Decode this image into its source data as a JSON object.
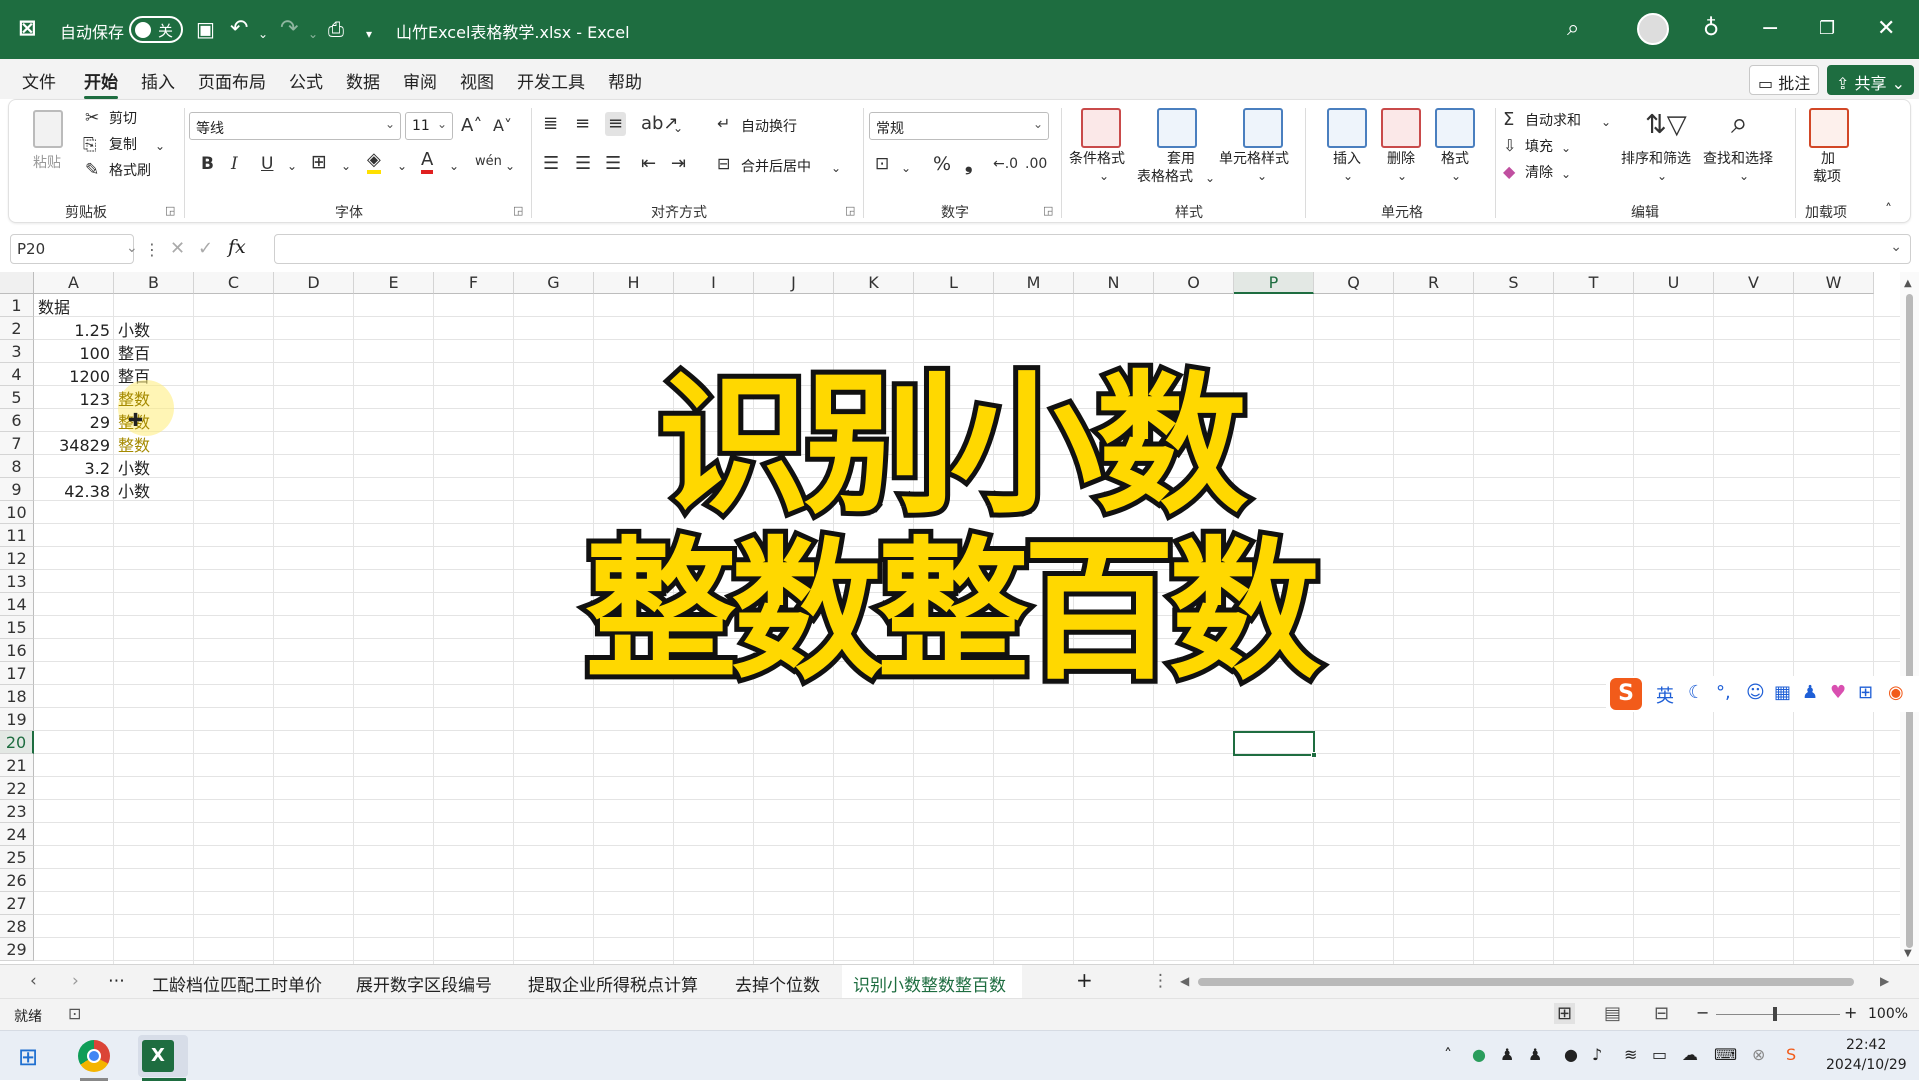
{
  "titlebar": {
    "autosave_label": "自动保存",
    "autosave_state": "关",
    "filename": "山竹Excel表格教学.xlsx - Excel",
    "app_icon": "excel-icon",
    "bg_color": "#1e6d40"
  },
  "menu": {
    "tabs": [
      "文件",
      "开始",
      "插入",
      "页面布局",
      "公式",
      "数据",
      "审阅",
      "视图",
      "开发工具",
      "帮助"
    ],
    "active": "开始",
    "comment_label": "批注",
    "share_label": "共享"
  },
  "ribbon": {
    "clipboard": {
      "paste": "粘贴",
      "cut": "剪切",
      "copy": "复制",
      "format_painter": "格式刷",
      "group": "剪贴板"
    },
    "font": {
      "name": "等线",
      "size": "11",
      "group": "字体",
      "bold": "B",
      "italic": "I",
      "underline": "U"
    },
    "alignment": {
      "wrap": "自动换行",
      "merge": "合并后居中",
      "group": "对齐方式"
    },
    "number": {
      "format": "常规",
      "group": "数字",
      "percent": "%"
    },
    "styles": {
      "conditional": "条件格式",
      "table_format_1": "套用",
      "table_format_2": "表格格式",
      "cell_styles": "单元格样式",
      "group": "样式"
    },
    "cells": {
      "insert": "插入",
      "delete": "删除",
      "format": "格式",
      "group": "单元格"
    },
    "editing": {
      "autosum": "自动求和",
      "fill": "填充",
      "clear": "清除",
      "sort": "排序和筛选",
      "find": "查找和选择",
      "group": "编辑"
    },
    "addins": {
      "label1": "加",
      "label2": "载项",
      "group": "加载项"
    }
  },
  "formula_bar": {
    "name_box": "P20",
    "formula": "",
    "fx": "fx"
  },
  "columns": [
    "A",
    "B",
    "C",
    "D",
    "E",
    "F",
    "G",
    "H",
    "I",
    "J",
    "K",
    "L",
    "M",
    "N",
    "O",
    "P",
    "Q",
    "R",
    "S",
    "T",
    "U",
    "V",
    "W"
  ],
  "selected_column": "P",
  "selected_row": "20",
  "rows": [
    "1",
    "2",
    "3",
    "4",
    "5",
    "6",
    "7",
    "8",
    "9",
    "10",
    "11",
    "12",
    "13",
    "14",
    "15",
    "16",
    "17",
    "18",
    "19",
    "20",
    "21",
    "22",
    "23",
    "24",
    "25",
    "26",
    "27",
    "28",
    "29"
  ],
  "cells": {
    "A1": "数据",
    "A2": "1.25",
    "B2": "小数",
    "A3": "100",
    "B3": "整百",
    "A4": "1200",
    "B4": "整百",
    "A5": "123",
    "B5": "整数",
    "A6": "29",
    "B6": "整数",
    "A7": "34829",
    "B7": "整数",
    "A8": "3.2",
    "B8": "小数",
    "A9": "42.38",
    "B9": "小数"
  },
  "overlay": {
    "line1": "识别小数",
    "line2": "整数整百数",
    "fill_color": "#ffd800",
    "stroke_color": "#111111"
  },
  "sheet_tabs": [
    "工龄档位匹配工时单价",
    "展开数字区段编号",
    "提取企业所得税点计算",
    "去掉个位数",
    "识别小数整数整百数"
  ],
  "active_sheet": "识别小数整数整百数",
  "status": {
    "ready": "就绪",
    "zoom": "100%"
  },
  "ime": {
    "lang": "英"
  },
  "taskbar": {
    "time": "22:42",
    "date": "2024/10/29"
  }
}
